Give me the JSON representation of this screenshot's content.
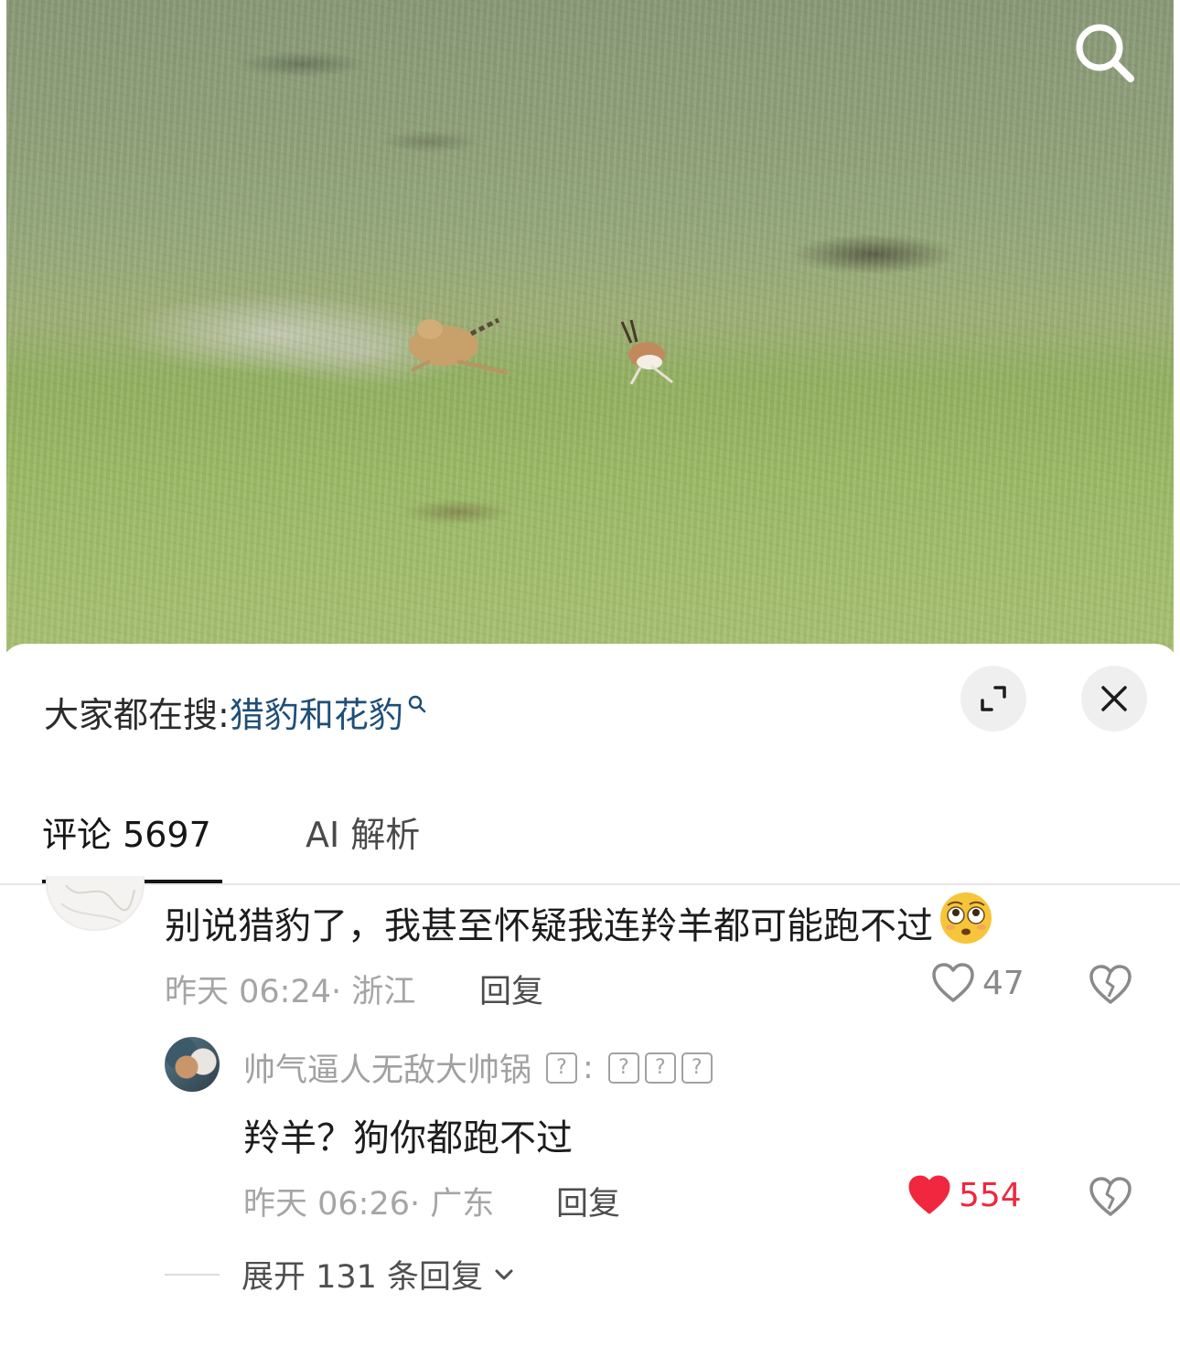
{
  "search_bar": {
    "prefix": "大家都在搜:",
    "term": "猎豹和花豹"
  },
  "tabs": [
    {
      "label": "评论 5697",
      "active": true
    },
    {
      "label": "AI 解析",
      "active": false
    }
  ],
  "comments": [
    {
      "text": "别说猎豹了，我甚至怀疑我连羚羊都可能跑不过",
      "emoji": "flushed-face-emoji",
      "meta": "昨天 06:24· 浙江",
      "reply_label": "回复",
      "like_count": "47",
      "liked": false
    }
  ],
  "replies": [
    {
      "username": "帅气逼人无敌大帅锅",
      "badge_glyph": "?",
      "separator": ":",
      "text": "羚羊？狗你都跑不过",
      "meta": "昨天 06:26· 广东",
      "reply_label": "回复",
      "like_count": "554",
      "liked": true
    }
  ],
  "expand_replies": {
    "label": "展开 131 条回复"
  },
  "colors": {
    "accent_link": "#1f4e79",
    "like_active": "#f0273f",
    "meta_gray": "#a5a5a5"
  }
}
